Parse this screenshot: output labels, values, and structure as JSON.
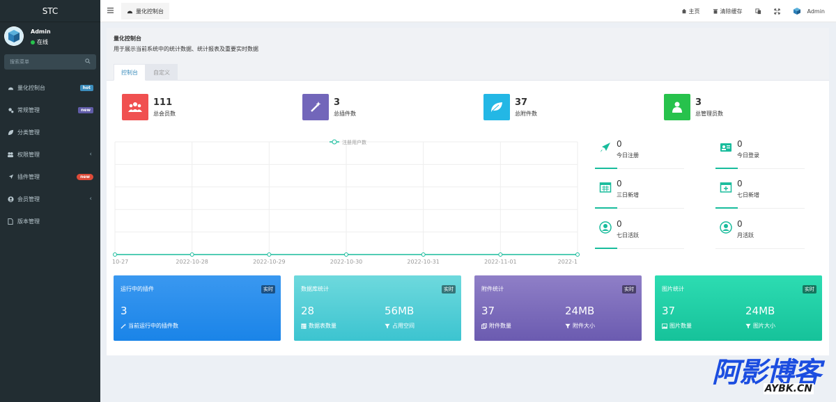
{
  "sidebar": {
    "brand": "STC",
    "user_name": "Admin",
    "user_status": "在线",
    "search_placeholder": "搜索菜单",
    "items": [
      {
        "label": "量化控制台",
        "badge": "hot"
      },
      {
        "label": "常规管理",
        "badge": "new"
      },
      {
        "label": "分类管理"
      },
      {
        "label": "权限管理",
        "caret": "‹"
      },
      {
        "label": "插件管理",
        "badge": "new"
      },
      {
        "label": "会员管理",
        "caret": "‹"
      },
      {
        "label": "版本管理"
      }
    ]
  },
  "topbar": {
    "menu_icon": "hamburger-icon",
    "tab_label": "量化控制台",
    "home_label": "主页",
    "clear_cache_label": "清除缓存",
    "user_label": "Admin"
  },
  "panel": {
    "title": "量化控制台",
    "description": "用于展示当前系统中的统计数据、统计报表及重要实时数据",
    "tabs": [
      "控制台",
      "自定义"
    ]
  },
  "stats": [
    {
      "value": "111",
      "label": "总会员数",
      "color": "#f05050"
    },
    {
      "value": "3",
      "label": "总插件数",
      "color": "#7266ba"
    },
    {
      "value": "37",
      "label": "总附件数",
      "color": "#23b7e5"
    },
    {
      "value": "3",
      "label": "总管理员数",
      "color": "#27c24c"
    }
  ],
  "chart_data": {
    "type": "line",
    "legend": [
      "注册用户数"
    ],
    "categories": [
      "10-27",
      "2022-10-28",
      "2022-10-29",
      "2022-10-30",
      "2022-10-31",
      "2022-11-01",
      "2022-1"
    ],
    "series": [
      {
        "name": "注册用户数",
        "values": [
          0,
          0,
          0,
          0,
          0,
          0,
          0
        ]
      }
    ],
    "ylim": [
      0,
      1
    ],
    "grid": true,
    "color": "#18bc9c"
  },
  "mini_stats": [
    {
      "value": "0",
      "label": "今日注册",
      "icon": "rocket-icon"
    },
    {
      "value": "0",
      "label": "今日登录",
      "icon": "id-card-icon"
    },
    {
      "value": "0",
      "label": "三日新增",
      "icon": "calendar-icon"
    },
    {
      "value": "0",
      "label": "七日新增",
      "icon": "calendar-plus-icon"
    },
    {
      "value": "0",
      "label": "七日活跃",
      "icon": "user-circle-icon"
    },
    {
      "value": "0",
      "label": "月活跃",
      "icon": "user-circle-icon"
    }
  ],
  "cards": [
    {
      "title": "运行中的插件",
      "badge": "实时",
      "value1": "3",
      "label1": "当前运行中的插件数"
    },
    {
      "title": "数据库统计",
      "badge": "实时",
      "value1": "28",
      "label1": "数据表数量",
      "value2": "56MB",
      "label2": "占用空间"
    },
    {
      "title": "附件统计",
      "badge": "实时",
      "value1": "37",
      "label1": "附件数量",
      "value2": "24MB",
      "label2": "附件大小"
    },
    {
      "title": "图片统计",
      "badge": "实时",
      "value1": "37",
      "label1": "图片数量",
      "value2": "24MB",
      "label2": "图片大小"
    }
  ],
  "watermark": {
    "main": "阿影博客",
    "sub": "AYBK.CN"
  }
}
